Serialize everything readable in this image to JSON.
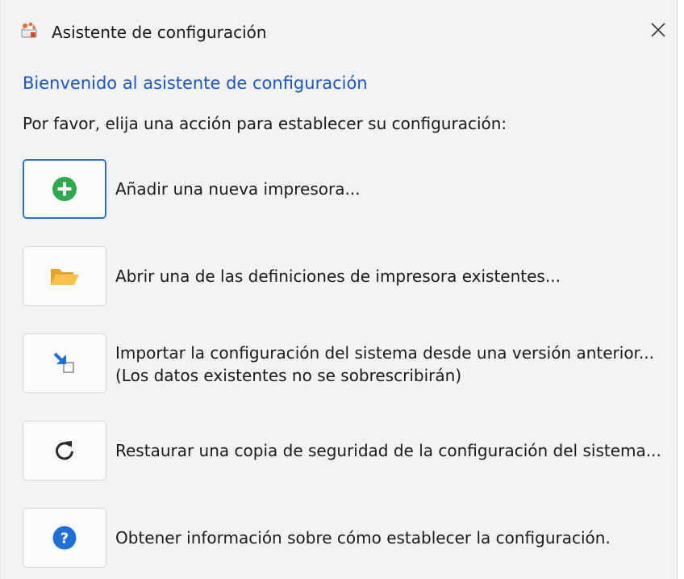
{
  "window": {
    "title": "Asistente de configuración",
    "close_label": "✕"
  },
  "heading": "Bienvenido al asistente de configuración",
  "subtitle": "Por favor, elija una acción para establecer su configuración:",
  "actions": [
    {
      "icon": "add-circle-icon",
      "label": "Añadir una nueva impresora...",
      "focused": true
    },
    {
      "icon": "open-folder-icon",
      "label": "Abrir una de las definiciones de impresora existentes..."
    },
    {
      "icon": "import-icon",
      "label": "Importar la configuración del sistema desde una versión anterior...",
      "note": "(Los datos existentes no se sobrescribirán)"
    },
    {
      "icon": "restore-icon",
      "label": "Restaurar una copia de seguridad de la configuración del sistema..."
    },
    {
      "icon": "help-icon",
      "label": "Obtener información sobre cómo establecer la configuración."
    }
  ],
  "colors": {
    "heading": "#1a56c8",
    "add_icon": "#2fa84f",
    "folder_icon": "#f5b942",
    "import_icon": "#1e6fd9",
    "help_icon": "#1f6fd6",
    "focus_border": "#2b6ed6"
  }
}
